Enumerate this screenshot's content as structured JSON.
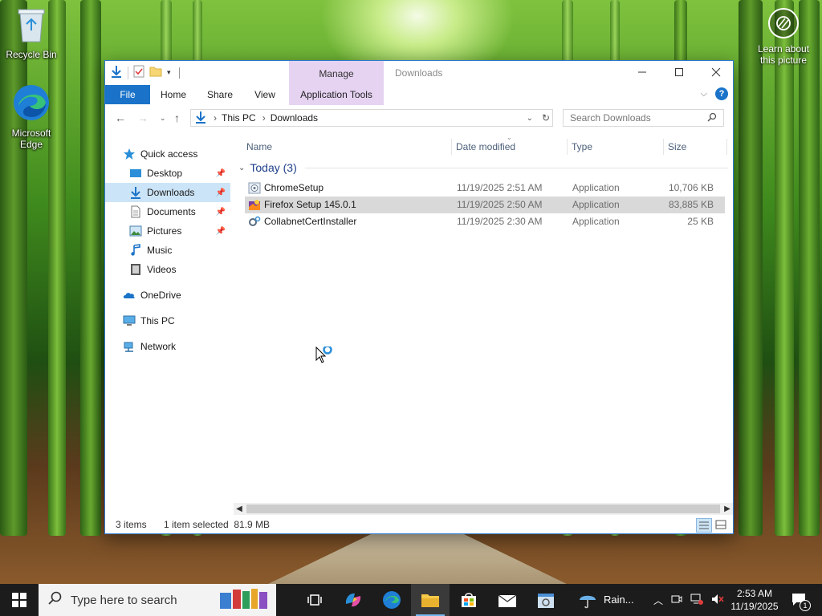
{
  "desktop": {
    "icons": [
      {
        "label": "Recycle Bin"
      },
      {
        "label": "Microsoft Edge"
      }
    ],
    "learn_label": "Learn about this picture"
  },
  "window": {
    "title": "Downloads",
    "contextual_group": "Manage",
    "ribbon_tabs": [
      "File",
      "Home",
      "Share",
      "View",
      "Application Tools"
    ],
    "address": {
      "segments": [
        "This PC",
        "Downloads"
      ]
    },
    "search": {
      "placeholder": "Search Downloads"
    },
    "nav": {
      "quick_access": "Quick access",
      "items": [
        {
          "label": "Desktop",
          "pinned": true
        },
        {
          "label": "Downloads",
          "pinned": true,
          "selected": true
        },
        {
          "label": "Documents",
          "pinned": true
        },
        {
          "label": "Pictures",
          "pinned": true
        },
        {
          "label": "Music",
          "pinned": false
        },
        {
          "label": "Videos",
          "pinned": false
        }
      ],
      "onedrive": "OneDrive",
      "thispc": "This PC",
      "network": "Network"
    },
    "columns": [
      "Name",
      "Date modified",
      "Type",
      "Size"
    ],
    "group_label": "Today (3)",
    "files": [
      {
        "name": "ChromeSetup",
        "date": "11/19/2025 2:51 AM",
        "type": "Application",
        "size": "10,706 KB",
        "selected": false
      },
      {
        "name": "Firefox Setup 145.0.1",
        "date": "11/19/2025 2:50 AM",
        "type": "Application",
        "size": "83,885 KB",
        "selected": true
      },
      {
        "name": "CollabnetCertInstaller",
        "date": "11/19/2025 2:30 AM",
        "type": "Application",
        "size": "25 KB",
        "selected": false
      }
    ],
    "status": {
      "count": "3 items",
      "selection": "1 item selected  81.9 MB"
    }
  },
  "taskbar": {
    "search_placeholder": "Type here to search",
    "weather": "Rain...",
    "time": "2:53 AM",
    "date": "11/19/2025",
    "notification_count": "1"
  },
  "colors": {
    "accent": "#1a73c9",
    "manage_tab": "#e6d3f2",
    "selection": "#cce4f7",
    "taskbar": "#1c1c1c"
  }
}
